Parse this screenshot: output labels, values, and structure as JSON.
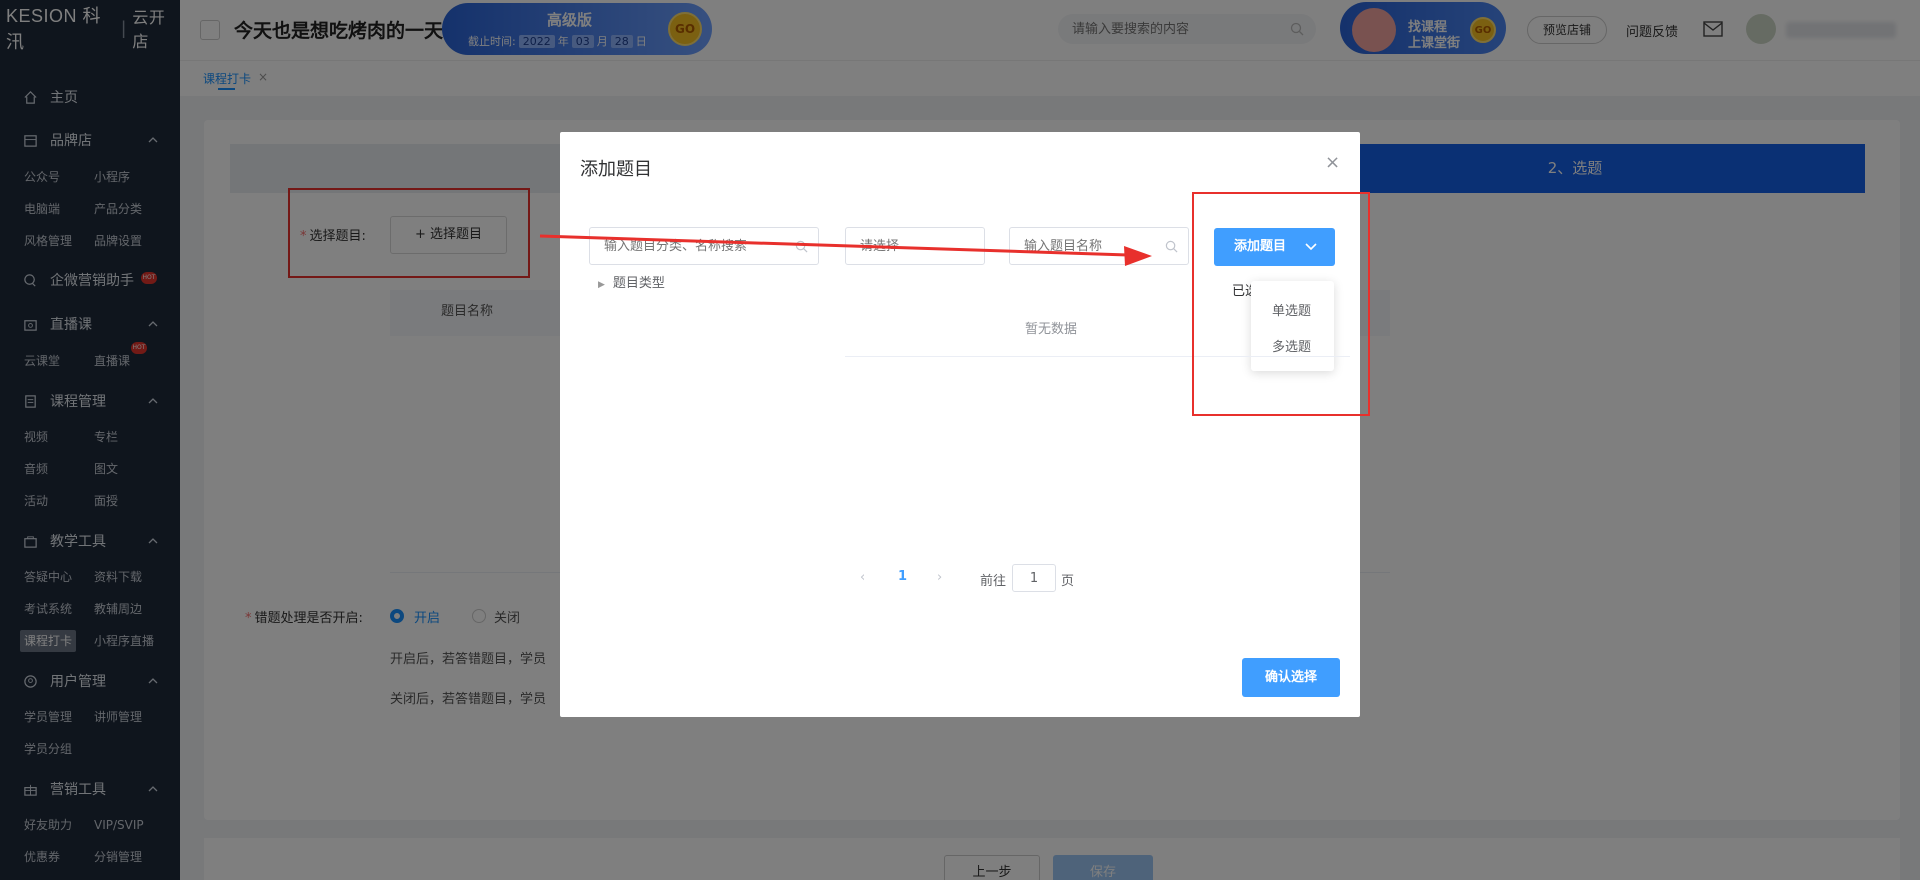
{
  "sidebar": {
    "logo": "KESION 科汛",
    "logo_sub": "云开店",
    "home": "主页",
    "groups": [
      {
        "label": "品牌店",
        "items": [
          "公众号",
          "小程序",
          "电脑端",
          "产品分类",
          "风格管理",
          "品牌设置"
        ]
      },
      {
        "label": "企微营销助手",
        "hot": "HOT"
      },
      {
        "label": "直播课",
        "items": [
          "云课堂",
          "直播课"
        ]
      },
      {
        "label": "课程管理",
        "items": [
          "视频",
          "专栏",
          "音频",
          "图文",
          "活动",
          "面授"
        ]
      },
      {
        "label": "教学工具",
        "items": [
          "答疑中心",
          "资料下载",
          "考试系统",
          "教辅周边",
          "课程打卡",
          "小程序直播"
        ]
      },
      {
        "label": "用户管理",
        "items": [
          "学员管理",
          "讲师管理",
          "学员分组"
        ]
      },
      {
        "label": "营销工具",
        "items": [
          "好友助力",
          "VIP/SVIP",
          "优惠券",
          "分销管理"
        ]
      }
    ]
  },
  "header": {
    "shop_title": "今天也是想吃烤肉的一天",
    "version": {
      "title": "高级版",
      "expire_label": "截止时间:",
      "year": "2022",
      "year_unit": "年",
      "month": "03",
      "month_unit": "月",
      "day": "28",
      "day_unit": "日",
      "go": "GO"
    },
    "search_placeholder": "请输入要搜索的内容",
    "course_banner": {
      "line1": "找课程",
      "line2": "上课堂街",
      "go": "GO"
    },
    "preview_shop": "预览店铺",
    "feedback": "问题反馈"
  },
  "tabs": {
    "current": "课程打卡",
    "close": "×"
  },
  "page": {
    "step2": "2、选题",
    "select_label": "选择题目:",
    "select_button": "+ 选择题目",
    "table_col_name": "题目名称",
    "wrong_label": "错题处理是否开启:",
    "radio_on": "开启",
    "radio_off": "关闭",
    "desc_on": "开启后，若答错题目，学员",
    "desc_off": "关闭后，若答错题目，学员",
    "prev": "上一步",
    "save": "保存"
  },
  "dialog": {
    "title": "添加题目",
    "close": "×",
    "category_placeholder": "输入题目分类、名称搜索",
    "tree_node": "题目类型",
    "type_placeholder": "请选择",
    "name_placeholder": "输入题目名称",
    "add_button": "添加题目",
    "selected_label": "已选",
    "dropdown": [
      "单选题",
      "多选题"
    ],
    "empty": "暂无数据",
    "pagination": {
      "current": "1",
      "goto_label": "前往",
      "goto_value": "1",
      "unit": "页"
    },
    "confirm": "确认选择"
  },
  "colors": {
    "sidebar_bg": "#1f2a3a",
    "primary": "#409eff",
    "step_active": "#1460e8",
    "annotation_red": "#e8302c"
  }
}
